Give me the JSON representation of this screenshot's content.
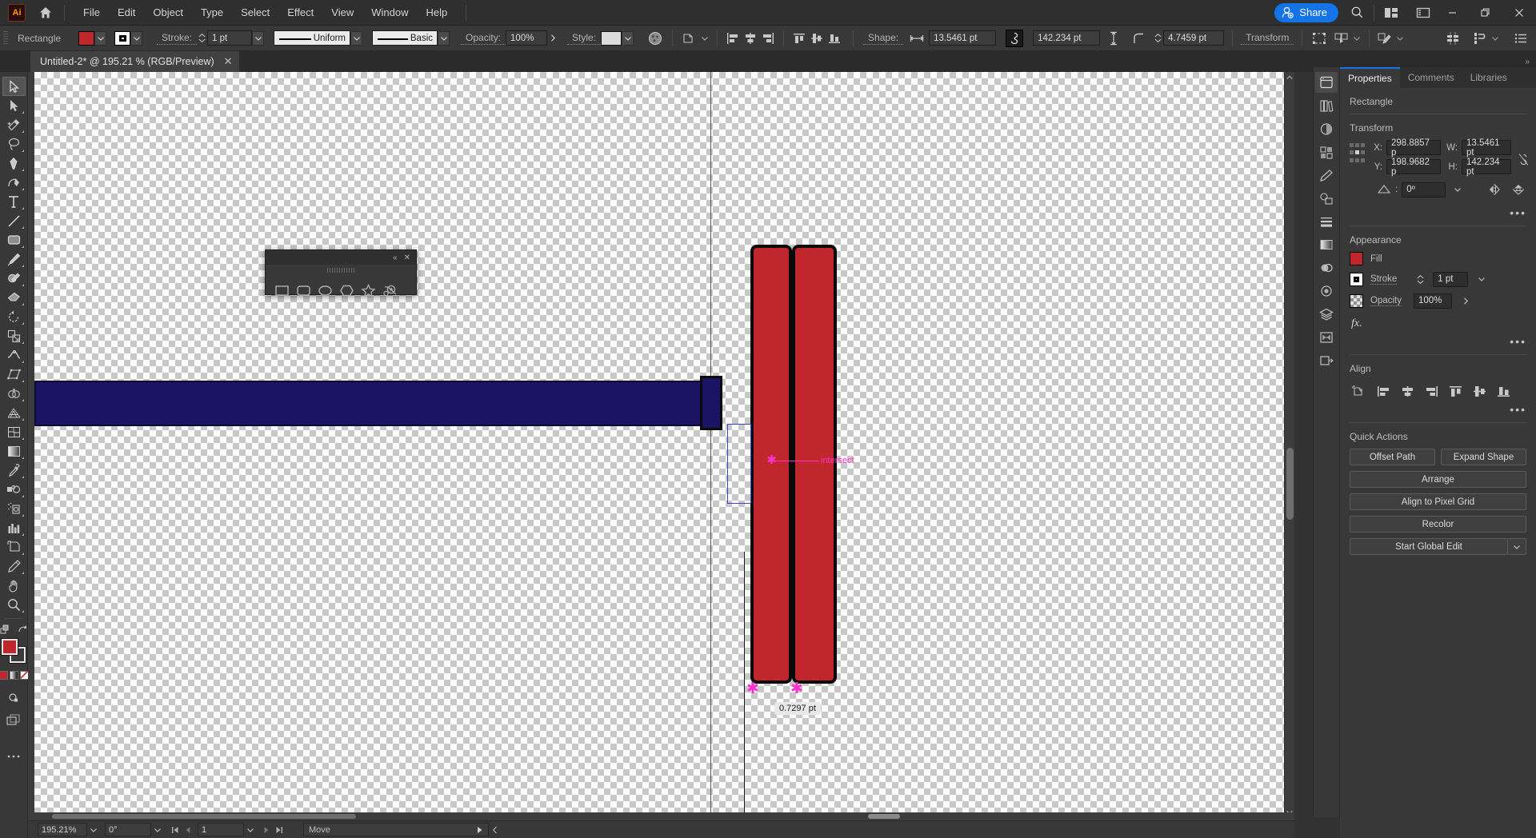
{
  "app": {
    "logo": "Ai",
    "home_icon": "home-icon"
  },
  "menubar": {
    "items": [
      "File",
      "Edit",
      "Object",
      "Type",
      "Select",
      "Effect",
      "View",
      "Window",
      "Help"
    ],
    "share_label": "Share",
    "search_icon": "search-icon",
    "arrange_icon": "arrange-documents-icon",
    "workspace_icon": "workspace-switcher-icon",
    "minimize": "–",
    "maximize": "❐",
    "close": "✕"
  },
  "controlbar": {
    "object_type": "Rectangle",
    "fill_color": "#c0272d",
    "stroke_label": "Stroke:",
    "stroke_weight": "1 pt",
    "stroke_profile": "Uniform",
    "brush_definition": "Basic",
    "opacity_label": "Opacity:",
    "opacity_value": "100%",
    "style_label": "Style:",
    "shape_label": "Shape:",
    "shape_width": "13.5461 pt",
    "shape_height": "142.234 pt",
    "corner_radius": "4.7459 pt",
    "transform_label": "Transform",
    "link_icon": "link-dimensions-icon",
    "recolor_icon": "recolor-artwork-icon",
    "align_left_icon": "align-left-icon",
    "align_center_h_icon": "align-center-horizontal-icon",
    "align_right_icon": "align-right-icon",
    "align_top_icon": "align-top-icon",
    "align_middle_icon": "align-middle-vertical-icon",
    "align_bottom_icon": "align-bottom-icon",
    "isolate_icon": "isolate-selected-icon",
    "select_similar_icon": "select-similar-icon",
    "edit_toolbar_icon": "edit-toolbar-icon",
    "distribute_icon": "distribute-spacing-icon",
    "arrange_icon": "arrange-icon",
    "options_icon": "more-options-icon"
  },
  "tabbar": {
    "document_title": "Untitled-2* @ 195.21 % (RGB/Preview)",
    "close_icon": "✕"
  },
  "toolbar": {
    "tools": [
      {
        "name": "selection-tool",
        "active": true
      },
      {
        "name": "direct-selection-tool",
        "active": false
      },
      {
        "name": "magic-wand-tool",
        "active": false
      },
      {
        "name": "lasso-tool",
        "active": false
      },
      {
        "name": "pen-tool",
        "active": false
      },
      {
        "name": "curvature-tool",
        "active": false
      },
      {
        "name": "type-tool",
        "active": false
      },
      {
        "name": "line-segment-tool",
        "active": false
      },
      {
        "name": "rectangle-tool",
        "active": false
      },
      {
        "name": "paintbrush-tool",
        "active": false
      },
      {
        "name": "shaper-tool",
        "active": false
      },
      {
        "name": "eraser-tool",
        "active": false
      },
      {
        "name": "rotate-tool",
        "active": false
      },
      {
        "name": "scale-tool",
        "active": false
      },
      {
        "name": "width-tool",
        "active": false
      },
      {
        "name": "free-transform-tool",
        "active": false
      },
      {
        "name": "shape-builder-tool",
        "active": false
      },
      {
        "name": "perspective-grid-tool",
        "active": false
      },
      {
        "name": "mesh-tool",
        "active": false
      },
      {
        "name": "gradient-tool",
        "active": false
      },
      {
        "name": "eyedropper-tool",
        "active": false
      },
      {
        "name": "blend-tool",
        "active": false
      },
      {
        "name": "symbol-sprayer-tool",
        "active": false
      },
      {
        "name": "column-graph-tool",
        "active": false
      },
      {
        "name": "artboard-tool",
        "active": false
      },
      {
        "name": "slice-tool",
        "active": false
      },
      {
        "name": "hand-tool",
        "active": false
      },
      {
        "name": "zoom-tool",
        "active": false
      }
    ],
    "fill_color": "#c0272d",
    "stroke_color": "#000000",
    "swap_icon": "swap-fill-stroke-icon",
    "default_icon": "default-fill-stroke-icon",
    "color_mode_icons": [
      "color-swatch-icon",
      "gradient-icon",
      "none-icon"
    ],
    "draw_mode_icon": "drawing-modes-icon",
    "screen_mode_icon": "screen-mode-icon",
    "more_icon": "more-tools-icon"
  },
  "shapes_panel": {
    "collapse_icon": "«",
    "close_icon": "✕",
    "tools": [
      "rectangle-tool",
      "rounded-rectangle-tool",
      "ellipse-tool",
      "polygon-tool",
      "star-tool",
      "flare-tool"
    ]
  },
  "canvas": {
    "smart_guide_label": "intersect",
    "measure_tooltip": "0.7297 pt",
    "blue_shape_color": "#1b1464",
    "red_shape_color": "#c0272d",
    "guide_color": "#ff30d0"
  },
  "statusbar": {
    "zoom_level": "195.21%",
    "rotation": "0°",
    "artboard_number": "1",
    "status_text": "Move",
    "first_icon": "first-artboard-icon",
    "prev_icon": "previous-artboard-icon",
    "next_icon": "next-artboard-icon",
    "last_icon": "last-artboard-icon"
  },
  "dock": {
    "icons": [
      "properties-icon",
      "libraries-icon",
      "color-icon",
      "swatches-icon",
      "brushes-icon",
      "symbols-icon",
      "stroke-icon",
      "gradient-icon",
      "transparency-icon",
      "appearance-icon",
      "layers-icon",
      "artboards-icon",
      "asset-export-icon"
    ]
  },
  "properties": {
    "tabs": [
      {
        "label": "Properties",
        "active": true
      },
      {
        "label": "Comments",
        "active": false
      },
      {
        "label": "Libraries",
        "active": false
      }
    ],
    "object_name": "Rectangle",
    "transform": {
      "title": "Transform",
      "x_label": "X:",
      "x_value": "298.8857 p",
      "y_label": "Y:",
      "y_value": "198.9682 p",
      "w_label": "W:",
      "w_value": "13.5461 pt",
      "h_label": "H:",
      "h_value": "142.234 pt",
      "angle_value": "0º",
      "constrain_icon": "unlink-proportions-icon",
      "flip_h_icon": "flip-horizontal-icon",
      "flip_v_icon": "flip-vertical-icon",
      "more_icon": "more-options-icon"
    },
    "appearance": {
      "title": "Appearance",
      "fill_label": "Fill",
      "fill_color": "#c0272d",
      "stroke_label": "Stroke",
      "stroke_weight": "1 pt",
      "opacity_label": "Opacity",
      "opacity_value": "100%",
      "fx_label": "fx.",
      "more_icon": "more-options-icon"
    },
    "align": {
      "title": "Align",
      "align_to_icon": "align-to-selection-icon",
      "icons": [
        "align-left-icon",
        "align-center-horizontal-icon",
        "align-right-icon",
        "align-top-icon",
        "align-middle-vertical-icon",
        "align-bottom-icon"
      ],
      "more_icon": "more-options-icon"
    },
    "quick_actions": {
      "title": "Quick Actions",
      "offset_path": "Offset Path",
      "expand_shape": "Expand Shape",
      "arrange": "Arrange",
      "align_pixel_grid": "Align to Pixel Grid",
      "recolor": "Recolor",
      "start_global_edit": "Start Global Edit"
    }
  }
}
